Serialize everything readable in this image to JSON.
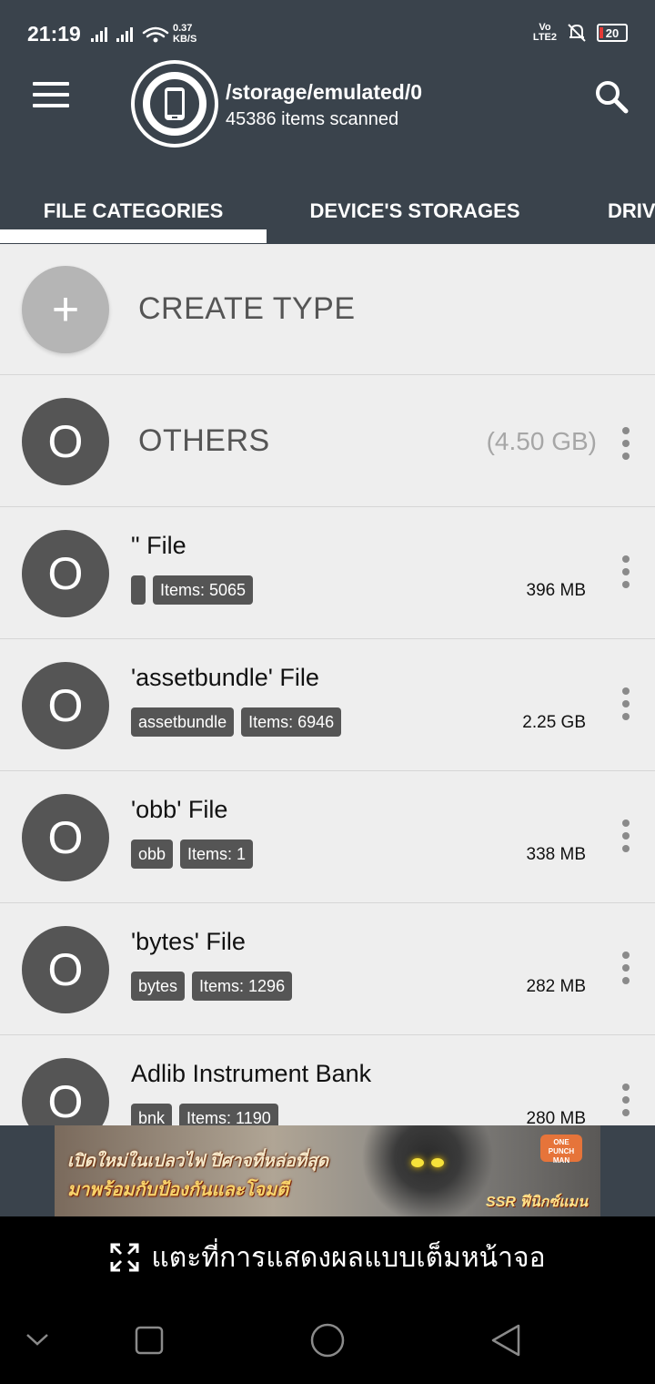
{
  "status": {
    "time": "21:19",
    "net_speed_value": "0.37",
    "net_speed_unit": "KB/S",
    "lte_top": "Vo",
    "lte_bottom": "LTE2",
    "battery": "20"
  },
  "header": {
    "path": "/storage/emulated/0",
    "items_scanned": "45386 items scanned"
  },
  "tabs": [
    {
      "label": "FILE CATEGORIES",
      "active": true
    },
    {
      "label": "DEVICE'S STORAGES",
      "active": false
    },
    {
      "label": "DRIV",
      "active": false
    }
  ],
  "list": {
    "create": {
      "icon_text": "+",
      "label": "CREATE TYPE"
    },
    "others": {
      "icon_text": "O",
      "label": "OTHERS",
      "size": "(4.50 GB)"
    },
    "files": [
      {
        "icon_text": "O",
        "title": "\" File",
        "tag": "",
        "items": "Items: 5065",
        "size": "396 MB"
      },
      {
        "icon_text": "O",
        "title": "'assetbundle' File",
        "tag": "assetbundle",
        "items": "Items: 6946",
        "size": "2.25 GB"
      },
      {
        "icon_text": "O",
        "title": "'obb' File",
        "tag": "obb",
        "items": "Items: 1",
        "size": "338 MB"
      },
      {
        "icon_text": "O",
        "title": "'bytes' File",
        "tag": "bytes",
        "items": "Items: 1296",
        "size": "282 MB"
      },
      {
        "icon_text": "O",
        "title": "Adlib Instrument Bank",
        "tag": "bnk",
        "items": "Items: 1190",
        "size": "280 MB"
      }
    ]
  },
  "ad": {
    "line1": "เปิดใหม่ในเปลวไฟ ปีศาจที่หล่อที่สุด",
    "line2": "มาพร้อมกับป้องกันและโจมตี",
    "tag": "SSR ฟีนิกซ์แมน",
    "logo": "ONE PUNCH MAN"
  },
  "fullscreen_hint": "แตะที่การแสดงผลแบบเต็มหน้าจอ",
  "colors": {
    "header_bg": "#3a434c",
    "list_bg": "#eeeeee",
    "badge_bg": "#555555",
    "create_circle": "#b5b5b5"
  }
}
